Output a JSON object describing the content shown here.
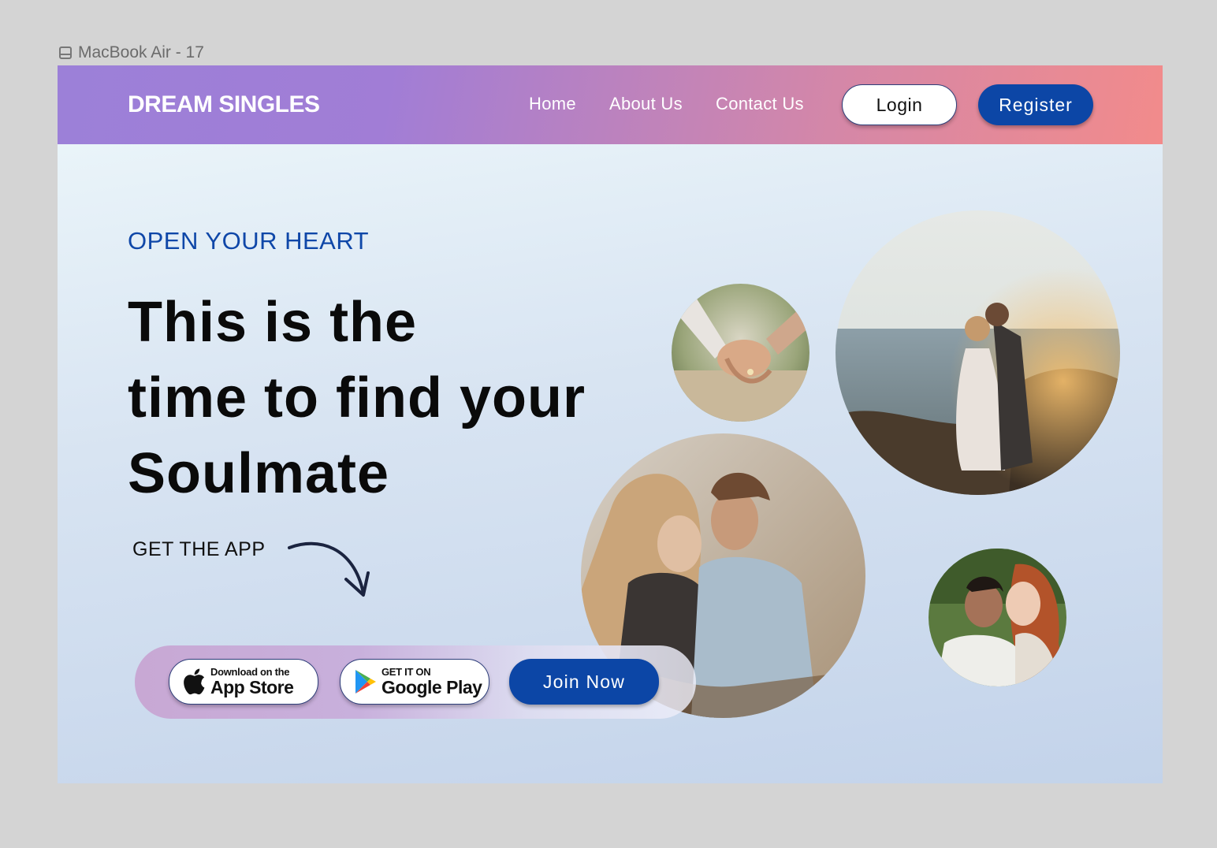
{
  "frame_label": "MacBook Air - 17",
  "nav": {
    "brand": "DREAM SINGLES",
    "links": [
      "Home",
      "About Us",
      "Contact Us"
    ],
    "login_label": "Login",
    "register_label": "Register"
  },
  "hero": {
    "eyebrow": "OPEN YOUR HEART",
    "headline_lines": [
      "This is the",
      "time to find your",
      "Soulmate"
    ],
    "get_app": "GET THE APP"
  },
  "cta": {
    "app_store_small": "Download on the",
    "app_store_big": "App Store",
    "google_play_small": "GET IT ON",
    "google_play_big": "Google Play",
    "join_label": "Join Now"
  },
  "colors": {
    "primary_blue": "#0c46a6",
    "eyebrow_blue": "#0f47a8",
    "nav_gradient_start": "#9c80d8",
    "nav_gradient_end": "#f28b8b"
  },
  "icons": {
    "frame": "frame-icon",
    "apple": "apple-icon",
    "google_play": "google-play-icon",
    "arrow": "curved-arrow-icon"
  }
}
